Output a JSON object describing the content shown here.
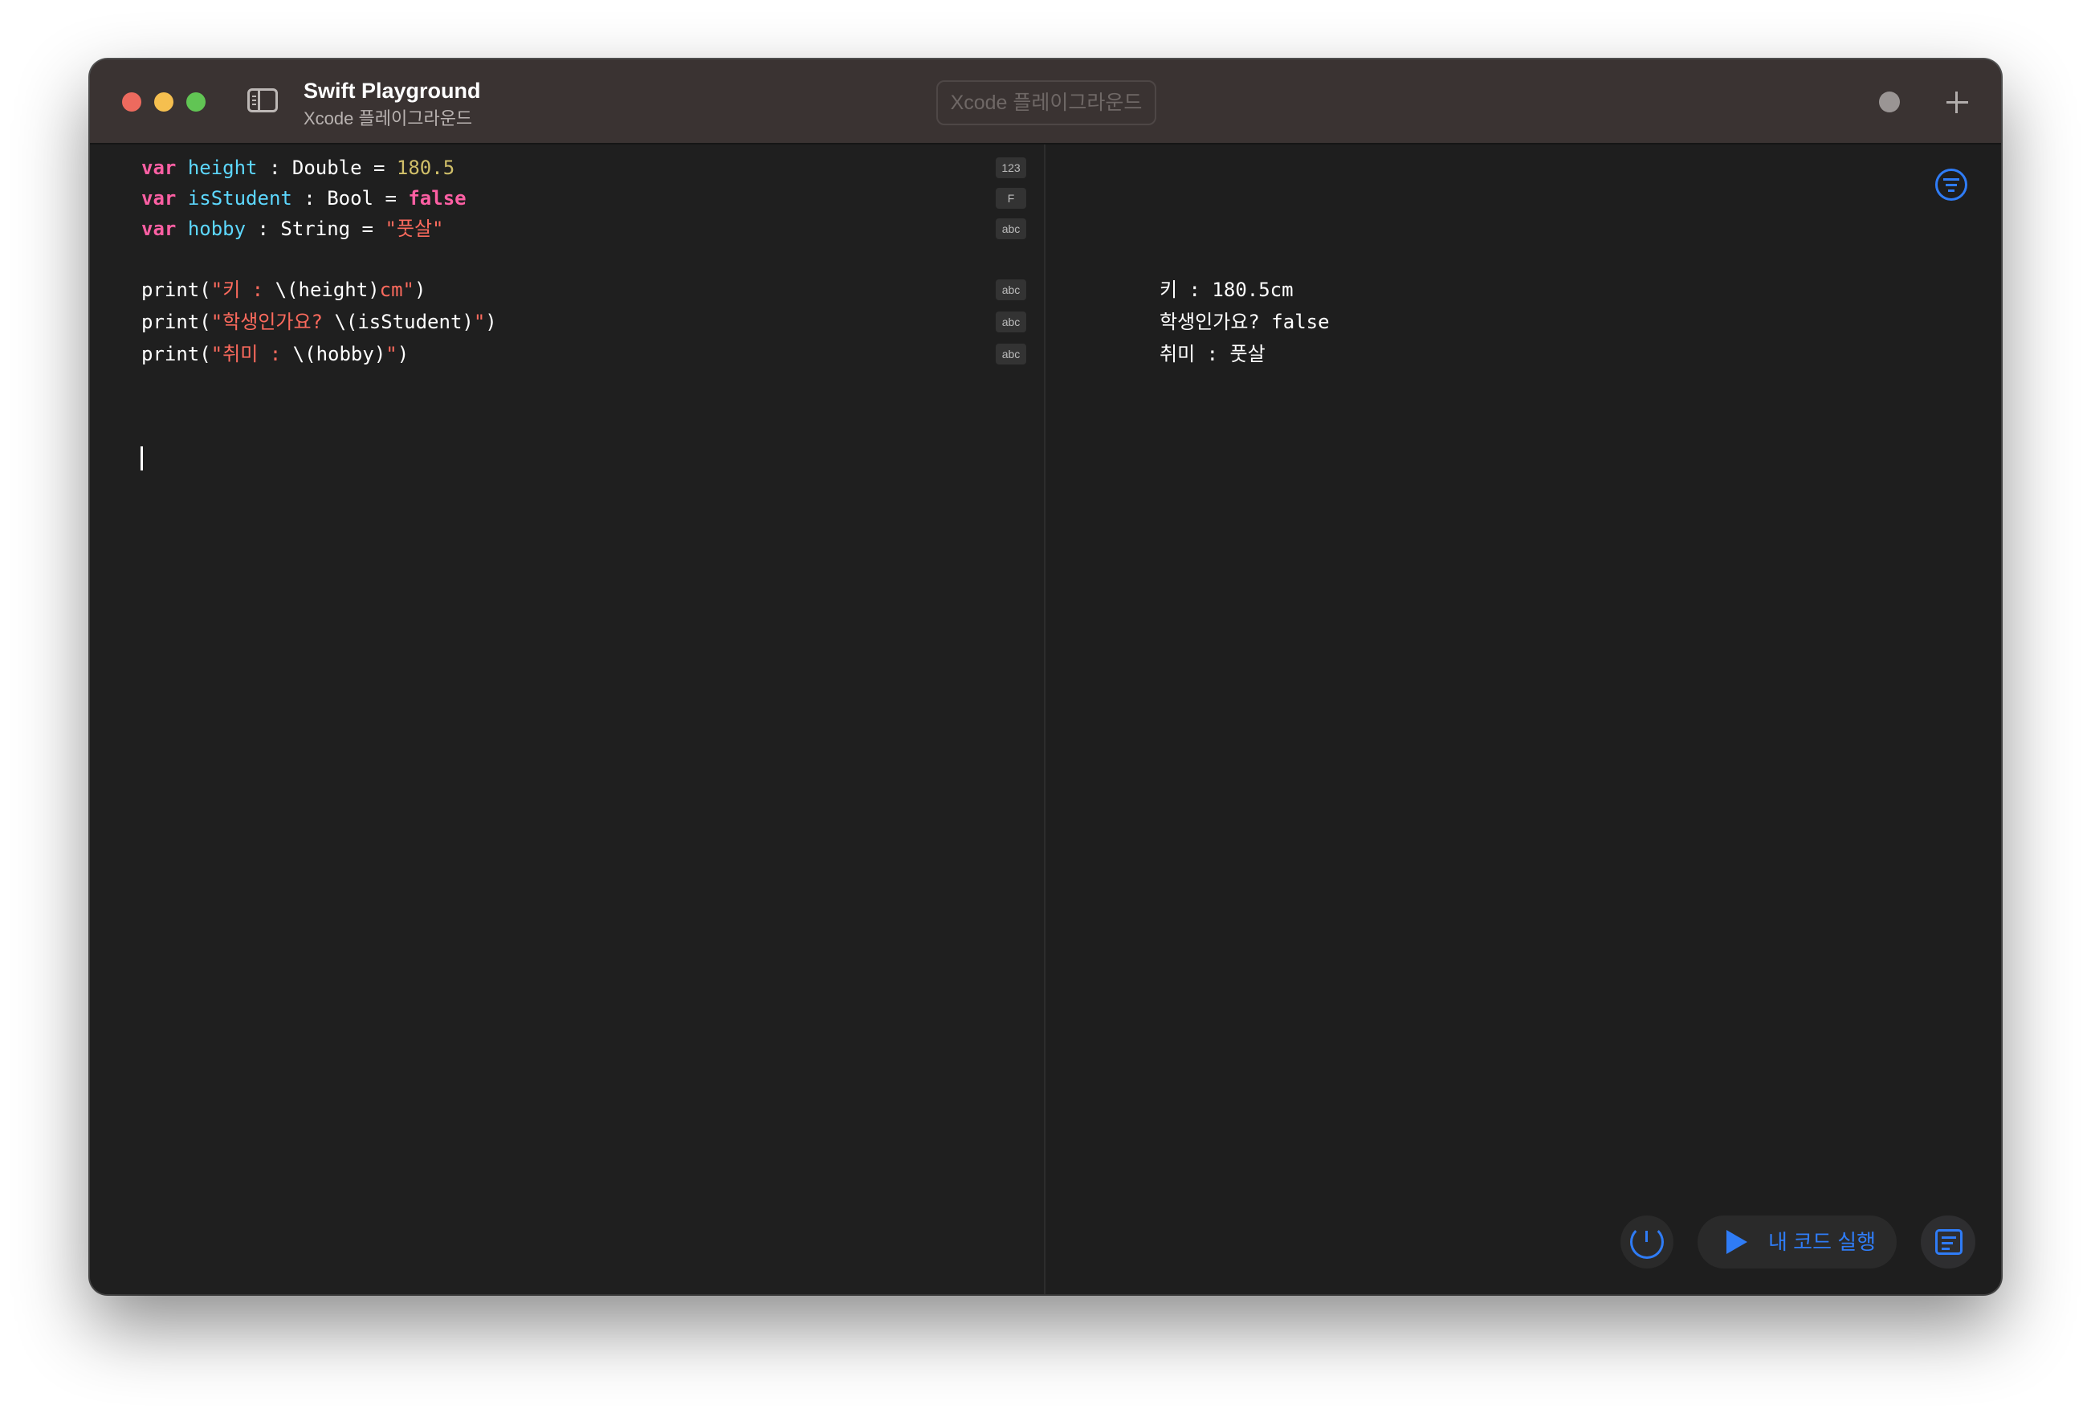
{
  "window": {
    "title": "Swift Playground",
    "subtitle": "Xcode 플레이그라운드",
    "search_placeholder": "Xcode 플레이그라운드"
  },
  "editor": {
    "lines": [
      {
        "keyword": "var",
        "name": "height",
        "type": " : Double = ",
        "value": "180.5",
        "badge": "123"
      },
      {
        "keyword": "var",
        "name": "isStudent",
        "type": " : Bool = ",
        "value": "false",
        "badge": "F"
      },
      {
        "keyword": "var",
        "name": "hobby",
        "type": " : String = ",
        "value": "\"풋살\"",
        "badge": "abc"
      }
    ],
    "prints": [
      {
        "pre": "print(",
        "s1": "\"키 : ",
        "interp": "\\(height)",
        "s2": "cm\"",
        "post": ")",
        "badge": "abc"
      },
      {
        "pre": "print(",
        "s1": "\"학생인가요? ",
        "interp": "\\(isStudent)",
        "s2": "\"",
        "post": ")",
        "badge": "abc"
      },
      {
        "pre": "print(",
        "s1": "\"취미 : ",
        "interp": "\\(hobby)",
        "s2": "\"",
        "post": ")",
        "badge": "abc"
      }
    ]
  },
  "output": {
    "lines": [
      "키 : 180.5cm",
      "학생인가요? false",
      "취미 : 풋살"
    ]
  },
  "toolbar": {
    "run_label": "내 코드 실행"
  },
  "colors": {
    "keyword": "#fc5fa3",
    "identifier": "#5dd8ff",
    "number": "#d0bf69",
    "string": "#fc6a5d",
    "accent": "#2f7cf6"
  }
}
